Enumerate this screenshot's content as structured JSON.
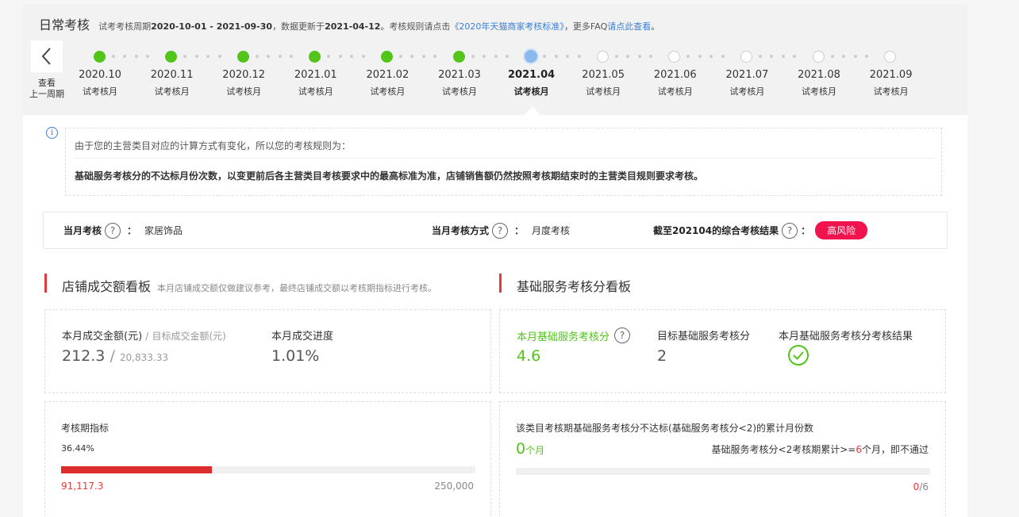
{
  "header": {
    "title": "日常考核",
    "desc_prefix": "试考考核周期",
    "period": "2020-10-01 - 2021-09-30",
    "desc_mid": "，数据更新于",
    "updated": "2021-04-12",
    "desc_rule": "。考核规则请点击",
    "rule_link": "《2020年天猫商家考核标准》",
    "desc_faq": "，更多FAQ",
    "faq_link": "请点此查看",
    "desc_end": "。"
  },
  "prev_period": {
    "line1": "查看",
    "line2": "上一周期"
  },
  "timeline": {
    "months": [
      {
        "label": "2020.10",
        "sub": "试考核月",
        "state": "done"
      },
      {
        "label": "2020.11",
        "sub": "试考核月",
        "state": "done"
      },
      {
        "label": "2020.12",
        "sub": "试考核月",
        "state": "done"
      },
      {
        "label": "2021.01",
        "sub": "试考核月",
        "state": "done"
      },
      {
        "label": "2021.02",
        "sub": "试考核月",
        "state": "done"
      },
      {
        "label": "2021.03",
        "sub": "试考核月",
        "state": "done"
      },
      {
        "label": "2021.04",
        "sub": "试考核月",
        "state": "current"
      },
      {
        "label": "2021.05",
        "sub": "试考核月",
        "state": "future"
      },
      {
        "label": "2021.06",
        "sub": "试考核月",
        "state": "future"
      },
      {
        "label": "2021.07",
        "sub": "试考核月",
        "state": "future"
      },
      {
        "label": "2021.08",
        "sub": "试考核月",
        "state": "future"
      },
      {
        "label": "2021.09",
        "sub": "试考核月",
        "state": "future"
      }
    ]
  },
  "notice": {
    "line1": "由于您的主营类目对应的计算方式有变化，所以您的考核规则为：",
    "line2": "基础服务考核分的不达标月份次数，以变更前后各主营类目考核要求中的最高标准为准，店铺销售额仍然按照考核期结束时的主营类目规则要求考核。"
  },
  "assessment": {
    "month_label": "当月考核",
    "month_value": "家居饰品",
    "method_label": "当月考核方式",
    "method_value": "月度考核",
    "result_label": "截至202104的综合考核结果",
    "result_value": "高风险",
    "colon": "："
  },
  "sales_board": {
    "title": "店铺成交额看板",
    "subtitle": "本月店铺成交额仅做建议参考，最终店铺成交额以考核期指标进行考核。",
    "amount_label": "本月成交金额(元)",
    "slash": "/",
    "target_label": "目标成交金额(元)",
    "amount_value": "212.3",
    "target_value": "20,833.33",
    "progress_label": "本月成交进度",
    "progress_value": "1.01%",
    "period_label": "考核期指标",
    "period_percent": "36.44%",
    "period_fraction": 0.3644,
    "period_current": "91,117.3",
    "period_target": "250,000"
  },
  "service_board": {
    "title": "基础服务考核分看板",
    "score_label": "本月基础服务考核分",
    "score_value": "4.6",
    "target_label": "目标基础服务考核分",
    "target_value": "2",
    "result_label": "本月基础服务考核分考核结果",
    "result_icon": "check-circle-icon",
    "fail_title": "该类目考核期基础服务考核分不达标(基础服务考核分<2)的累计月份数",
    "fail_count": "0",
    "fail_unit": "个月",
    "rule_prefix": "基础服务考核分<2考核期累计>=",
    "rule_num": "6",
    "rule_suffix": "个月，即不通过",
    "fail_fraction": 0,
    "fail_current": "0",
    "fail_slash": "/",
    "fail_total": "6"
  },
  "colors": {
    "done": "#52c41a",
    "current": "#8ab8ef",
    "accent_red": "#e4393c",
    "risk": "#f0134d",
    "link": "#3c7fd4"
  }
}
